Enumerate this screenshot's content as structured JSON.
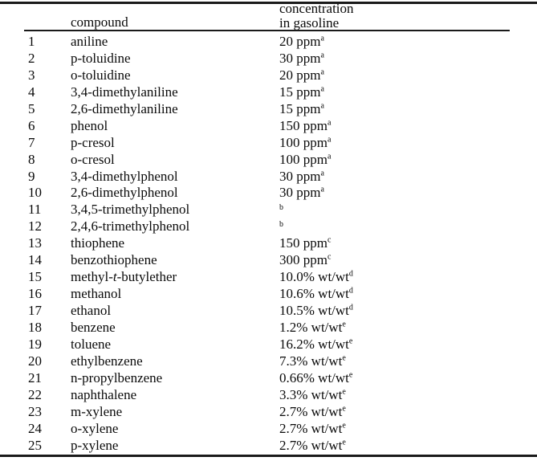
{
  "table": {
    "headers": {
      "index": "",
      "compound": "compound",
      "concentration_line1": "concentration",
      "concentration_line2": "in gasoline"
    },
    "rows": [
      {
        "index": "1",
        "compound": "aniline",
        "value": "20 ppm",
        "note": "a"
      },
      {
        "index": "2",
        "compound": "p-toluidine",
        "value": "30 ppm",
        "note": "a"
      },
      {
        "index": "3",
        "compound": "o-toluidine",
        "value": "20 ppm",
        "note": "a"
      },
      {
        "index": "4",
        "compound": "3,4-dimethylaniline",
        "value": "15 ppm",
        "note": "a"
      },
      {
        "index": "5",
        "compound": "2,6-dimethylaniline",
        "value": "15 ppm",
        "note": "a"
      },
      {
        "index": "6",
        "compound": "phenol",
        "value": "150 ppm",
        "note": "a"
      },
      {
        "index": "7",
        "compound": "p-cresol",
        "value": "100 ppm",
        "note": "a"
      },
      {
        "index": "8",
        "compound": "o-cresol",
        "value": "100 ppm",
        "note": "a"
      },
      {
        "index": "9",
        "compound": "3,4-dimethylphenol",
        "value": "30 ppm",
        "note": "a"
      },
      {
        "index": "10",
        "compound": "2,6-dimethylphenol",
        "value": "30 ppm",
        "note": "a"
      },
      {
        "index": "11",
        "compound": "3,4,5-trimethylphenol",
        "value": "",
        "note": "b"
      },
      {
        "index": "12",
        "compound": "2,4,6-trimethylphenol",
        "value": "",
        "note": "b"
      },
      {
        "index": "13",
        "compound": "thiophene",
        "value": "150 ppm",
        "note": "c"
      },
      {
        "index": "14",
        "compound": "benzothiophene",
        "value": "300 ppm",
        "note": "c"
      },
      {
        "index": "15",
        "compound": "methyl-t-butylether",
        "value": "10.0% wt/wt",
        "note": "d",
        "italic_part": "t"
      },
      {
        "index": "16",
        "compound": "methanol",
        "value": "10.6% wt/wt",
        "note": "d"
      },
      {
        "index": "17",
        "compound": "ethanol",
        "value": "10.5% wt/wt",
        "note": "d"
      },
      {
        "index": "18",
        "compound": "benzene",
        "value": "1.2% wt/wt",
        "note": "e"
      },
      {
        "index": "19",
        "compound": "toluene",
        "value": "16.2% wt/wt",
        "note": "e"
      },
      {
        "index": "20",
        "compound": "ethylbenzene",
        "value": "7.3% wt/wt",
        "note": "e"
      },
      {
        "index": "21",
        "compound": "n-propylbenzene",
        "value": "0.66% wt/wt",
        "note": "e"
      },
      {
        "index": "22",
        "compound": "naphthalene",
        "value": "3.3% wt/wt",
        "note": "e"
      },
      {
        "index": "23",
        "compound": "m-xylene",
        "value": "2.7% wt/wt",
        "note": "e"
      },
      {
        "index": "24",
        "compound": "o-xylene",
        "value": "2.7% wt/wt",
        "note": "e"
      },
      {
        "index": "25",
        "compound": "p-xylene",
        "value": "2.7% wt/wt",
        "note": "e"
      }
    ]
  }
}
